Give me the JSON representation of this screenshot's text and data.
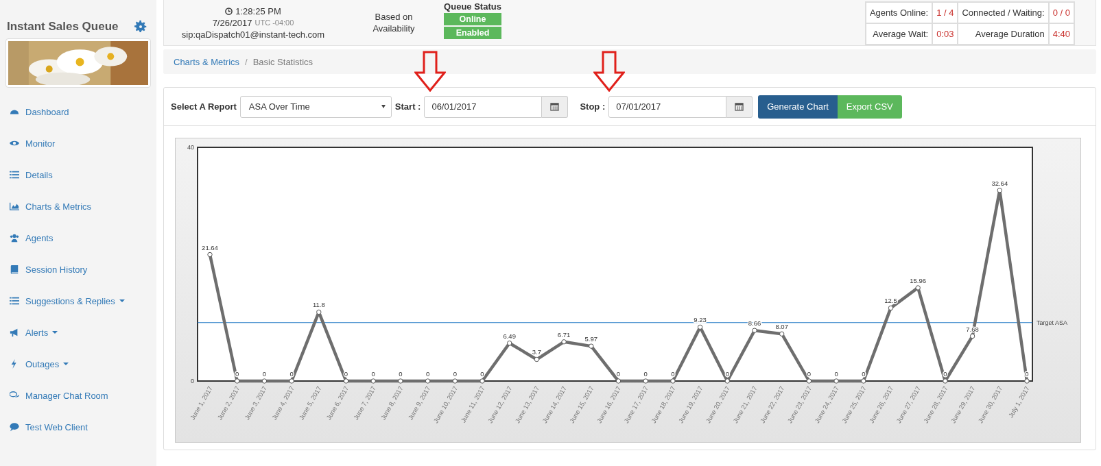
{
  "sidebar": {
    "title": "Instant Sales Queue",
    "items": [
      {
        "label": "Dashboard",
        "has_menu": false
      },
      {
        "label": "Monitor",
        "has_menu": false
      },
      {
        "label": "Details",
        "has_menu": false
      },
      {
        "label": "Charts & Metrics",
        "has_menu": false
      },
      {
        "label": "Agents",
        "has_menu": false
      },
      {
        "label": "Session History",
        "has_menu": false
      },
      {
        "label": "Suggestions & Replies",
        "has_menu": true
      },
      {
        "label": "Alerts",
        "has_menu": true
      },
      {
        "label": "Outages",
        "has_menu": true
      },
      {
        "label": "Manager Chat Room",
        "has_menu": false
      },
      {
        "label": "Test Web Client",
        "has_menu": false
      }
    ]
  },
  "header": {
    "time": "1:28:25 PM",
    "date": "7/26/2017",
    "timezone": "UTC -04:00",
    "sip": "sip:qaDispatch01@instant-tech.com",
    "routing": "Based on Availability",
    "queue_status": {
      "title": "Queue Status",
      "badges": [
        {
          "label": "Online",
          "on": true
        },
        {
          "label": "Enabled",
          "on": true
        }
      ]
    },
    "stats": [
      {
        "label": "Agents Online:",
        "value": "1 / 4"
      },
      {
        "label": "Connected / Waiting:",
        "value": "0 / 0"
      },
      {
        "label": "Average Wait:",
        "value": "0:03"
      },
      {
        "label": "Average Duration",
        "value": "4:40"
      }
    ]
  },
  "breadcrumb": {
    "separator": "/",
    "items": [
      {
        "label": "Charts & Metrics",
        "selected": false
      },
      {
        "label": "Basic Statistics",
        "selected": true
      }
    ]
  },
  "report": {
    "select_label": "Select A Report",
    "selected_report": "ASA Over Time",
    "start_label": "Start :",
    "start": "06/01/2017",
    "stop_label": "Stop :",
    "stop": "07/01/2017",
    "buttons": [
      {
        "label": "Generate Chart",
        "kind": "primary"
      },
      {
        "label": "Export CSV",
        "kind": "success"
      }
    ]
  },
  "chart_data": {
    "type": "line",
    "categories": [
      "June 1, 2017",
      "June 2, 2017",
      "June 3, 2017",
      "June 4, 2017",
      "June 5, 2017",
      "June 6, 2017",
      "June 7, 2017",
      "June 8, 2017",
      "June 9, 2017",
      "June 10, 2017",
      "June 11, 2017",
      "June 12, 2017",
      "June 13, 2017",
      "June 14, 2017",
      "June 15, 2017",
      "June 16, 2017",
      "June 17, 2017",
      "June 18, 2017",
      "June 19, 2017",
      "June 20, 2017",
      "June 21, 2017",
      "June 22, 2017",
      "June 23, 2017",
      "June 24, 2017",
      "June 25, 2017",
      "June 26, 2017",
      "June 27, 2017",
      "June 28, 2017",
      "June 29, 2017",
      "June 30, 2017",
      "July 1, 2017"
    ],
    "series": [
      {
        "color": "#6e6e6e",
        "marker": "circle",
        "values": [
          21.64,
          0,
          0,
          0,
          11.8,
          0,
          0,
          0,
          0,
          0,
          0,
          6.49,
          3.7,
          6.71,
          5.97,
          0,
          0,
          0,
          9.23,
          0,
          8.66,
          8.07,
          0,
          0,
          0,
          12.5,
          15.96,
          0,
          7.68,
          32.64,
          0
        ]
      }
    ],
    "ylim": [
      0,
      40
    ],
    "yticks": [
      0,
      40
    ],
    "data_labels": true,
    "ref_lines": [
      {
        "axis": "y",
        "value": 10,
        "label": "Target ASA",
        "color": "#1f77c4"
      }
    ]
  }
}
